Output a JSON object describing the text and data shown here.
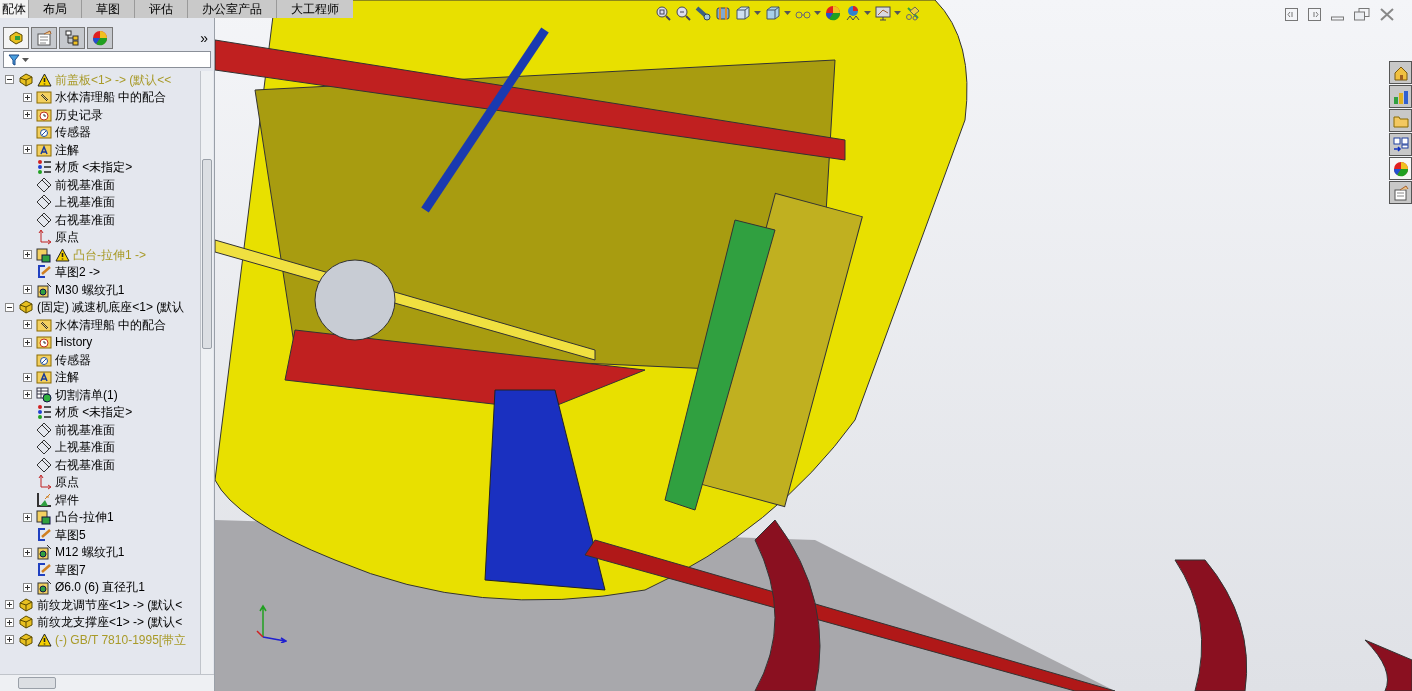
{
  "tabs": [
    {
      "label": "配体",
      "selected": true
    },
    {
      "label": "布局",
      "selected": false
    },
    {
      "label": "草图",
      "selected": false
    },
    {
      "label": "评估",
      "selected": false
    },
    {
      "label": "办公室产品",
      "selected": false
    },
    {
      "label": "大工程师",
      "selected": false
    }
  ],
  "panel_tabs": [
    {
      "selected": true
    },
    {
      "selected": false
    },
    {
      "selected": false
    },
    {
      "selected": false
    }
  ],
  "panel_more": "»",
  "tree": [
    {
      "label": "前盖板<1> -> (默认<<",
      "kind": "part",
      "warning": true,
      "expanded": true,
      "children": [
        {
          "label": "水体清理船 中的配合",
          "kind": "mates",
          "expanded": false
        },
        {
          "label": "历史记录",
          "kind": "history",
          "expanded": false
        },
        {
          "label": "传感器",
          "kind": "sensors"
        },
        {
          "label": "注解",
          "kind": "annotations",
          "expanded": false
        },
        {
          "label": "材质 <未指定>",
          "kind": "material"
        },
        {
          "label": "前视基准面",
          "kind": "plane"
        },
        {
          "label": "上视基准面",
          "kind": "plane"
        },
        {
          "label": "右视基准面",
          "kind": "plane"
        },
        {
          "label": "原点",
          "kind": "origin"
        },
        {
          "label": "凸台-拉伸1 ->",
          "kind": "feature",
          "warning": true,
          "expanded": false
        },
        {
          "label": "草图2 ->",
          "kind": "sketch"
        },
        {
          "label": "M30 螺纹孔1",
          "kind": "hole",
          "expanded": false
        }
      ]
    },
    {
      "label": "(固定) 减速机底座<1> (默认",
      "kind": "part",
      "expanded": true,
      "children": [
        {
          "label": "水体清理船 中的配合",
          "kind": "mates",
          "expanded": false
        },
        {
          "label": "History",
          "kind": "history",
          "expanded": false
        },
        {
          "label": "传感器",
          "kind": "sensors"
        },
        {
          "label": "注解",
          "kind": "annotations",
          "expanded": false
        },
        {
          "label": "切割清单(1)",
          "kind": "cutlist",
          "expanded": false
        },
        {
          "label": "材质 <未指定>",
          "kind": "material"
        },
        {
          "label": "前视基准面",
          "kind": "plane"
        },
        {
          "label": "上视基准面",
          "kind": "plane"
        },
        {
          "label": "右视基准面",
          "kind": "plane"
        },
        {
          "label": "原点",
          "kind": "origin"
        },
        {
          "label": "焊件",
          "kind": "weldment"
        },
        {
          "label": "凸台-拉伸1",
          "kind": "feature",
          "expanded": false
        },
        {
          "label": "草图5",
          "kind": "sketch"
        },
        {
          "label": "M12 螺纹孔1",
          "kind": "hole",
          "expanded": false
        },
        {
          "label": "草图7",
          "kind": "sketch"
        },
        {
          "label": "Ø6.0 (6) 直径孔1",
          "kind": "hole",
          "expanded": false
        }
      ]
    },
    {
      "label": "前纹龙调节座<1> -> (默认<",
      "kind": "part",
      "expanded": false
    },
    {
      "label": "前纹龙支撑座<1> -> (默认<",
      "kind": "part",
      "expanded": false
    },
    {
      "label": "(-) GB/T 7810-1995[带立",
      "kind": "part",
      "warning": true,
      "expanded": false
    }
  ],
  "task_pane": [
    {
      "selected": false
    },
    {
      "selected": false
    },
    {
      "selected": false
    },
    {
      "selected": false
    },
    {
      "selected": true
    },
    {
      "selected": false
    }
  ]
}
